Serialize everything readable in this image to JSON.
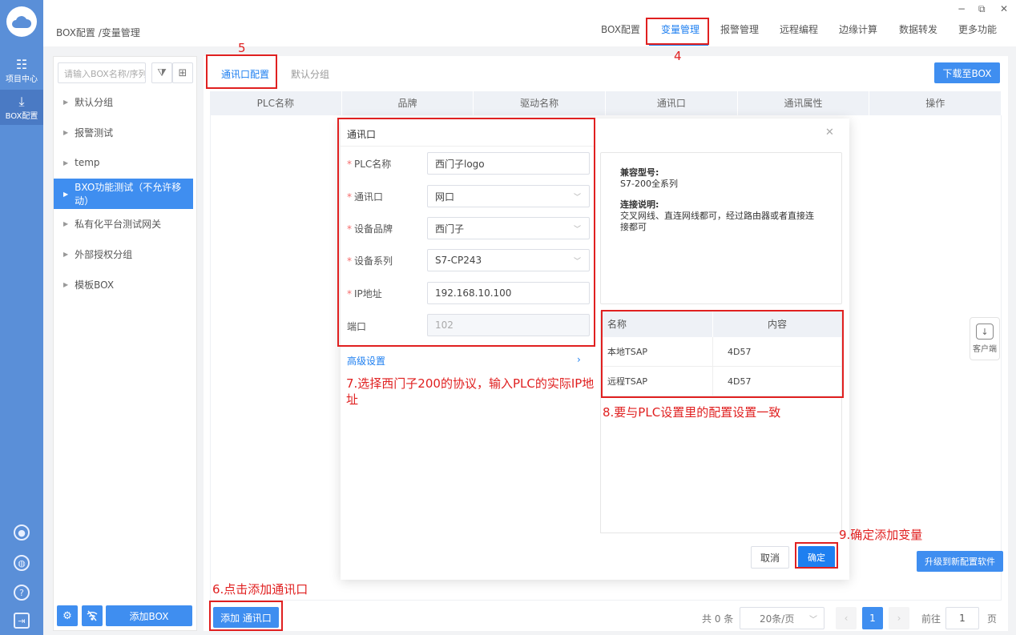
{
  "rail": {
    "items": [
      {
        "label": "项目中心",
        "icon": "grid-icon"
      },
      {
        "label": "BOX配置",
        "icon": "download-icon"
      }
    ],
    "bottom_icons": [
      "user-icon",
      "globe-icon",
      "help-icon",
      "exit-icon"
    ]
  },
  "topbar": {
    "breadcrumb": "BOX配置 /变量管理",
    "nav": [
      "BOX配置",
      "变量管理",
      "报警管理",
      "远程编程",
      "边缘计算",
      "数据转发",
      "更多功能"
    ],
    "window": {
      "minimize": "−",
      "restore": "⧉",
      "close": "✕"
    }
  },
  "sidebar": {
    "search_placeholder": "请输入BOX名称/序列",
    "groups": [
      "默认分组",
      "报警测试",
      "temp",
      "BXO功能测试（不允许移动）",
      "私有化平台测试网关",
      "外部授权分组",
      "模板BOX"
    ],
    "add_box": "添加BOX"
  },
  "main": {
    "tabs": [
      "通讯口配置",
      "默认分组"
    ],
    "download": "下载至BOX",
    "columns": [
      "PLC名称",
      "品牌",
      "驱动名称",
      "通讯口",
      "通讯属性",
      "操作"
    ],
    "add_port": "添加 通讯口",
    "upgrade": "升级到新配置软件",
    "client": "客户端"
  },
  "pagination": {
    "total": "共 0 条",
    "size": "20条/页",
    "current": "1",
    "goto": "前往",
    "goto_value": "1",
    "unit": "页"
  },
  "dialog": {
    "title": "通讯口",
    "fields": [
      {
        "label": "PLC名称",
        "value": "西门子logo"
      },
      {
        "label": "通讯口",
        "value": "网口"
      },
      {
        "label": "设备品牌",
        "value": "西门子"
      },
      {
        "label": "设备系列",
        "value": "S7-CP243"
      },
      {
        "label": "IP地址",
        "value": "192.168.10.100"
      },
      {
        "label": "端口",
        "value": "102"
      }
    ],
    "advanced": "高级设置",
    "info": {
      "model_title": "兼容型号:",
      "model_value": "S7-200全系列",
      "conn_title": "连接说明:",
      "conn_value": "交叉网线、直连网线都可，经过路由器或者直接连接都可"
    },
    "tsap": {
      "headers": [
        "名称",
        "内容"
      ],
      "rows": [
        {
          "name": "本地TSAP",
          "value": "4D57"
        },
        {
          "name": "远程TSAP",
          "value": "4D57"
        }
      ]
    },
    "cancel": "取消",
    "ok": "确定"
  },
  "annotations": {
    "n4": "4",
    "n5": "5",
    "n6": "6.点击添加通讯口",
    "n7": "7.选择西门子200的协议，输入PLC的实际IP地址",
    "n8": "8.要与PLC设置里的配置设置一致",
    "n9": "9.确定添加变量"
  },
  "colors": {
    "accent": "#3f8ef0",
    "rail": "#5a8fd8",
    "annotation": "#e02020"
  }
}
